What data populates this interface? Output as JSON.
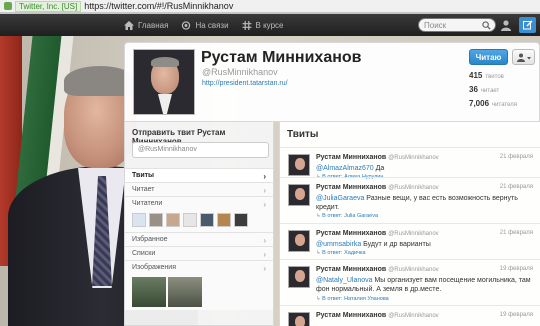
{
  "browser": {
    "cert": "Twitter, Inc. [US]",
    "url": "https://twitter.com/#!/RusMinnikhanov"
  },
  "topbar": {
    "nav": [
      {
        "label": "Главная",
        "icon": "home-icon"
      },
      {
        "label": "На связи",
        "icon": "at-icon"
      },
      {
        "label": "В курсе",
        "icon": "hash-icon"
      }
    ],
    "search_placeholder": "Поиск",
    "compose_icon": "compose-icon"
  },
  "profile": {
    "name": "Рустам Минниханов",
    "handle": "@RusMinnikhanov",
    "link": "http://president.tatarstan.ru/",
    "follow_label": "Читаю",
    "stats": [
      {
        "value": "415",
        "label": "твитов"
      },
      {
        "value": "36",
        "label": "читает"
      },
      {
        "value": "7,006",
        "label": "читателя"
      }
    ]
  },
  "sidebar": {
    "compose_title": "Отправить твит Рустам Минниханов",
    "compose_value": "@RusMinnikhanov",
    "items": [
      {
        "label": "Твиты"
      },
      {
        "label": "Читает"
      },
      {
        "label": "Читатели"
      },
      {
        "label": "Избранное"
      },
      {
        "label": "Списки"
      },
      {
        "label": "Изображения"
      }
    ]
  },
  "stream": {
    "title": "Твиты",
    "tweets": [
      {
        "name": "Рустам Минниханов",
        "handle": "@RusMinnikhanov",
        "date": "21 февраля",
        "mention": "@AlmazAlmaz670",
        "text": " Да",
        "reply_prefix": "В ответ:",
        "reply_to": "Алмаз Нурулин"
      },
      {
        "name": "Рустам Минниханов",
        "handle": "@RusMinnikhanov",
        "date": "21 февраля",
        "mention": "@JuliaGaraeva",
        "text": " Разные вещи, у вас есть возможность вернуть кредит.",
        "reply_prefix": "В ответ:",
        "reply_to": "Julia Garaeva"
      },
      {
        "name": "Рустам Минниханов",
        "handle": "@RusMinnikhanov",
        "date": "21 февраля",
        "mention": "@ummsabirka",
        "text": " Будут и др варианты",
        "reply_prefix": "В ответ:",
        "reply_to": "Хадичка"
      },
      {
        "name": "Рустам Минниханов",
        "handle": "@RusMinnikhanov",
        "date": "19 февраля",
        "mention": "@Nataly_Ulanova",
        "text": " Мы организует вам посещение могильника, там фон нормальный. А земля в др.месте.",
        "reply_prefix": "В ответ:",
        "reply_to": "Наталия Уланова"
      },
      {
        "name": "Рустам Минниханов",
        "handle": "@RusMinnikhanov",
        "date": "19 февраля",
        "mention": "",
        "text": "",
        "reply_prefix": "",
        "reply_to": ""
      }
    ]
  }
}
